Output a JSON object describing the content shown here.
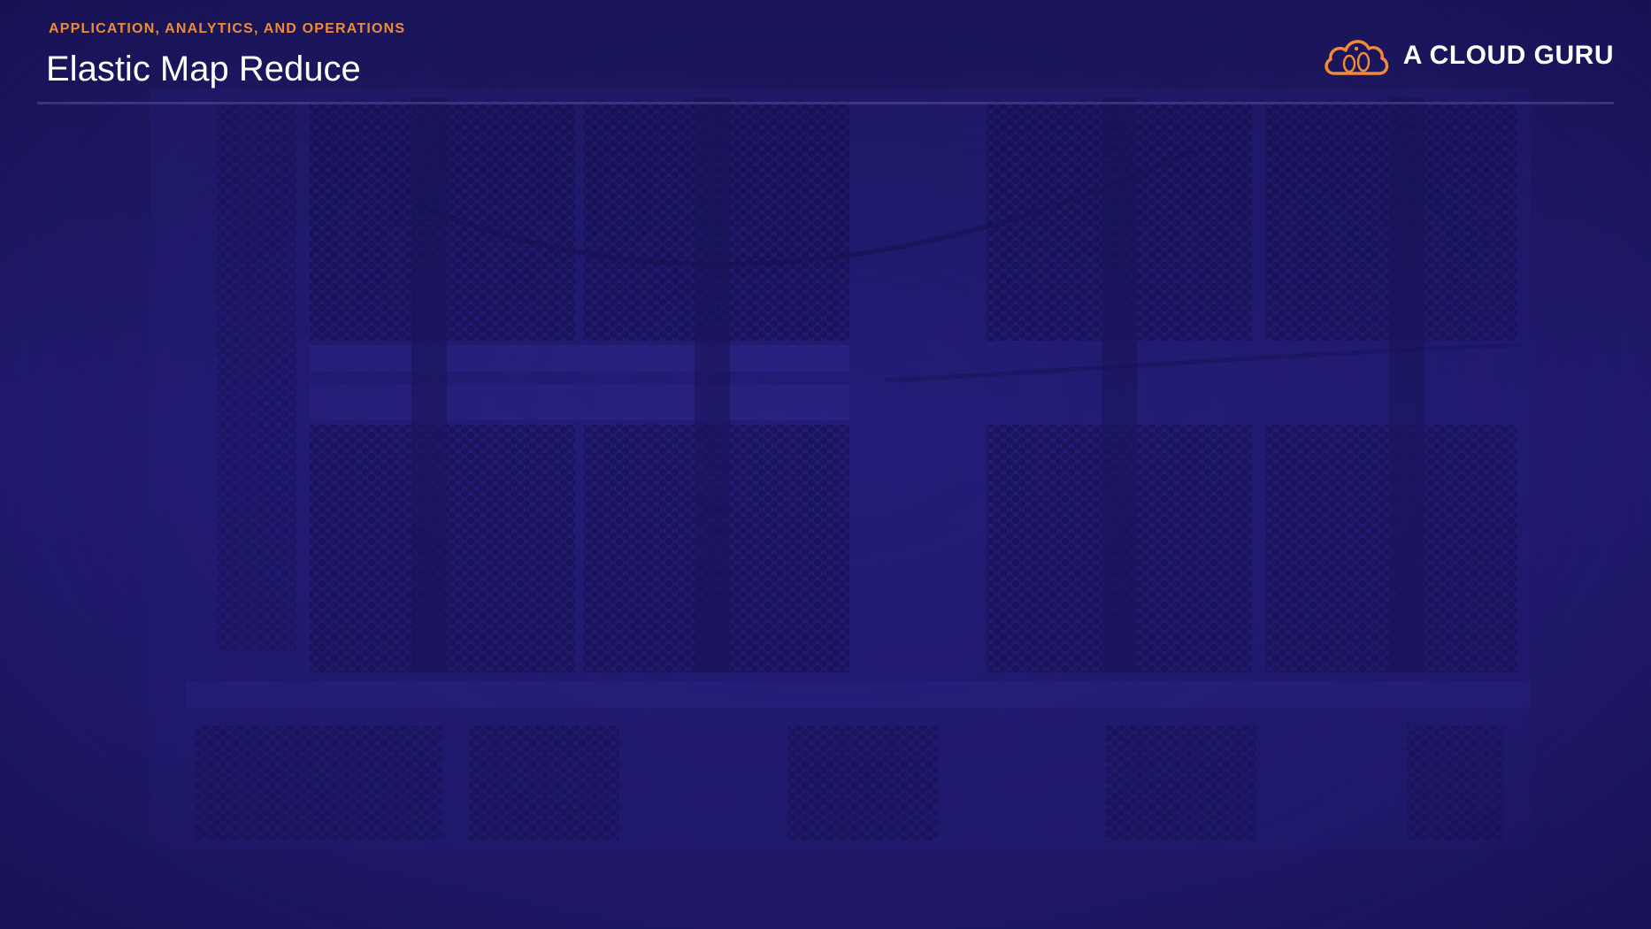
{
  "slide": {
    "section_label": "APPLICATION, ANALYTICS, AND OPERATIONS",
    "title": "Elastic Map Reduce"
  },
  "brand": {
    "name": "A CLOUD GURU",
    "logo_icon": "cloud-logo-icon",
    "accent_color": "#f08a37"
  },
  "background": {
    "description_icon": "server-rack-background",
    "overlay_color": "#221b74"
  }
}
